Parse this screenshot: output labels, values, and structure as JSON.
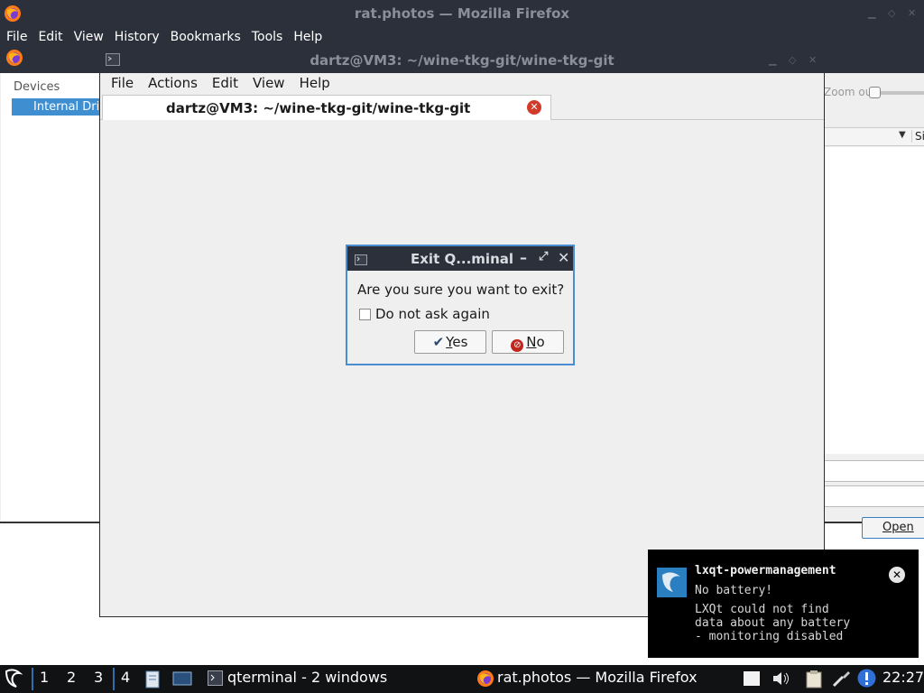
{
  "firefox": {
    "title": "rat.photos — Mozilla Firefox",
    "menu": [
      "File",
      "Edit",
      "View",
      "History",
      "Bookmarks",
      "Tools",
      "Help"
    ]
  },
  "file_dialog": {
    "devices_heading": "Devices",
    "internal_drive": "Internal Drive",
    "zoom_out": "Zoom out",
    "size_column": "Size",
    "open_button": "Open"
  },
  "terminal": {
    "title": "dartz@VM3: ~/wine-tkg-git/wine-tkg-git",
    "menu": [
      "File",
      "Actions",
      "Edit",
      "View",
      "Help"
    ],
    "tab_title": "dartz@VM3: ~/wine-tkg-git/wine-tkg-git"
  },
  "exit_dialog": {
    "title": "Exit Q...minal",
    "question": "Are you sure you want to exit?",
    "checkbox_label": "Do not ask again",
    "checkbox_checked": false,
    "yes_label_u": "Y",
    "yes_label_rest": "es",
    "no_label_u": "N",
    "no_label_rest": "o"
  },
  "notification": {
    "app": "lxqt-powermanagement",
    "summary": "No battery!",
    "body_lines": [
      "LXQt could not find",
      "data about any battery",
      "- monitoring disabled"
    ]
  },
  "taskbar": {
    "desktops": [
      "1",
      "2",
      "3",
      "4"
    ],
    "task_terminal": "qterminal - 2 windows",
    "task_firefox": "rat.photos — Mozilla Firefox",
    "clock": "22:27"
  },
  "colors": {
    "titlebar": "#2c303b",
    "selection": "#3e8ed0",
    "dialog_border": "#4a8dd0"
  }
}
